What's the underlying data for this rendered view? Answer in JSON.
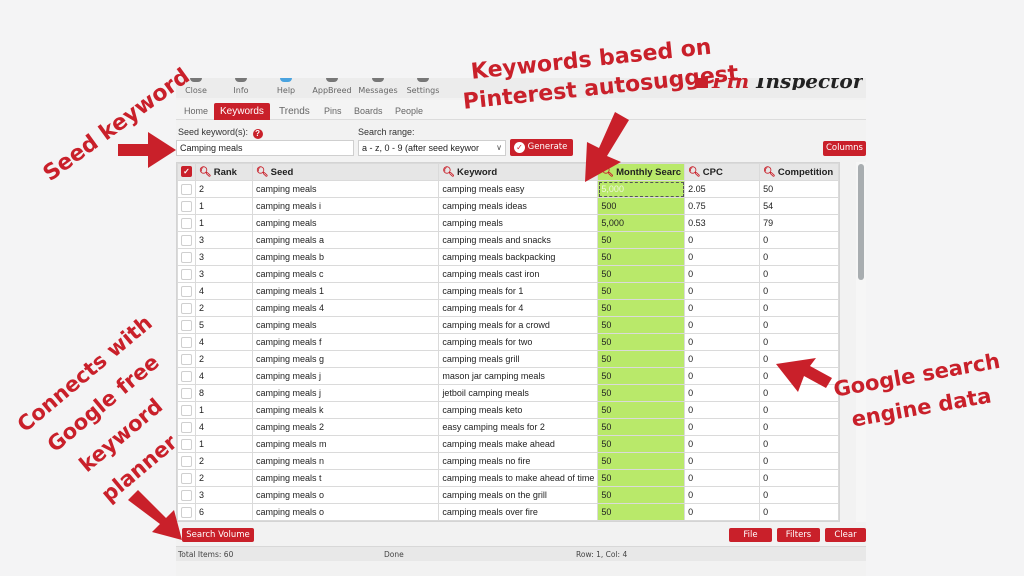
{
  "toolbar": {
    "items": [
      {
        "label": "Close",
        "icon": "close-icon"
      },
      {
        "label": "Info",
        "icon": "info-icon"
      },
      {
        "label": "Help",
        "icon": "help-icon"
      },
      {
        "label": "AppBreed",
        "icon": "appbreed-icon"
      },
      {
        "label": "Messages",
        "icon": "messages-icon"
      },
      {
        "label": "Settings",
        "icon": "settings-icon"
      }
    ],
    "logo": {
      "pin": "Pin",
      "rest": " Inspector"
    }
  },
  "tabs": [
    {
      "label": "Home",
      "active": false
    },
    {
      "label": "Keywords",
      "active": true
    },
    {
      "label": "Trends",
      "active": false
    },
    {
      "label": "Pins",
      "active": false
    },
    {
      "label": "Boards",
      "active": false
    },
    {
      "label": "People",
      "active": false
    }
  ],
  "form": {
    "seed_label": "Seed keyword(s):",
    "help_glyph": "?",
    "seed_value": "Camping meals",
    "range_label": "Search range:",
    "range_value": "a - z, 0 - 9 (after seed keywor",
    "generate_label": "Generate",
    "columns_label": "Columns"
  },
  "grid": {
    "columns": [
      "Rank",
      "Seed",
      "Keyword",
      "Monthly Searc",
      "CPC",
      "Competition"
    ],
    "rows": [
      {
        "rank": "2",
        "seed": "camping meals",
        "keyword": "camping meals easy",
        "monthly": "5,000",
        "cpc": "2.05",
        "competition": "50"
      },
      {
        "rank": "1",
        "seed": "camping meals i",
        "keyword": "camping meals ideas",
        "monthly": "500",
        "cpc": "0.75",
        "competition": "54"
      },
      {
        "rank": "1",
        "seed": "camping meals",
        "keyword": "camping meals",
        "monthly": "5,000",
        "cpc": "0.53",
        "competition": "79"
      },
      {
        "rank": "3",
        "seed": "camping meals a",
        "keyword": "camping meals and snacks",
        "monthly": "50",
        "cpc": "0",
        "competition": "0"
      },
      {
        "rank": "3",
        "seed": "camping meals b",
        "keyword": "camping meals backpacking",
        "monthly": "50",
        "cpc": "0",
        "competition": "0"
      },
      {
        "rank": "3",
        "seed": "camping meals c",
        "keyword": "camping meals cast iron",
        "monthly": "50",
        "cpc": "0",
        "competition": "0"
      },
      {
        "rank": "4",
        "seed": "camping meals 1",
        "keyword": "camping meals for 1",
        "monthly": "50",
        "cpc": "0",
        "competition": "0"
      },
      {
        "rank": "2",
        "seed": "camping meals 4",
        "keyword": "camping meals for 4",
        "monthly": "50",
        "cpc": "0",
        "competition": "0"
      },
      {
        "rank": "5",
        "seed": "camping meals",
        "keyword": "camping meals for a crowd",
        "monthly": "50",
        "cpc": "0",
        "competition": "0"
      },
      {
        "rank": "4",
        "seed": "camping meals f",
        "keyword": "camping meals for two",
        "monthly": "50",
        "cpc": "0",
        "competition": "0"
      },
      {
        "rank": "2",
        "seed": "camping meals g",
        "keyword": "camping meals grill",
        "monthly": "50",
        "cpc": "0",
        "competition": "0"
      },
      {
        "rank": "4",
        "seed": "camping meals j",
        "keyword": "mason jar camping meals",
        "monthly": "50",
        "cpc": "0",
        "competition": "0"
      },
      {
        "rank": "8",
        "seed": "camping meals j",
        "keyword": "jetboil camping meals",
        "monthly": "50",
        "cpc": "0",
        "competition": "0"
      },
      {
        "rank": "1",
        "seed": "camping meals k",
        "keyword": "camping meals keto",
        "monthly": "50",
        "cpc": "0",
        "competition": "0"
      },
      {
        "rank": "4",
        "seed": "camping meals 2",
        "keyword": "easy camping meals for 2",
        "monthly": "50",
        "cpc": "0",
        "competition": "0"
      },
      {
        "rank": "1",
        "seed": "camping meals m",
        "keyword": "camping meals make ahead",
        "monthly": "50",
        "cpc": "0",
        "competition": "0"
      },
      {
        "rank": "2",
        "seed": "camping meals n",
        "keyword": "camping meals no fire",
        "monthly": "50",
        "cpc": "0",
        "competition": "0"
      },
      {
        "rank": "2",
        "seed": "camping meals t",
        "keyword": "camping meals to make ahead of time",
        "monthly": "50",
        "cpc": "0",
        "competition": "0"
      },
      {
        "rank": "3",
        "seed": "camping meals o",
        "keyword": "camping meals on the grill",
        "monthly": "50",
        "cpc": "0",
        "competition": "0"
      },
      {
        "rank": "6",
        "seed": "camping meals o",
        "keyword": "camping meals over fire",
        "monthly": "50",
        "cpc": "0",
        "competition": "0"
      }
    ]
  },
  "buttons": {
    "search_volume": "Search Volume",
    "file": "File",
    "filters": "Filters",
    "clear": "Clear"
  },
  "status": {
    "total": "Total Items: 60",
    "state": "Done",
    "position": "Row: 1, Col: 4"
  },
  "annotations": {
    "seed": "Seed keyword",
    "autosuggest_1": "Keywords based on",
    "autosuggest_2": "Pinterest autosuggest",
    "google_1": "Google search",
    "google_2": "engine data",
    "planner_1": "Connects with",
    "planner_2": "Google free",
    "planner_3": "keyword",
    "planner_4": "planner"
  },
  "colors": {
    "accent": "#c9202a",
    "monthly_search_bg": "#b9e96a"
  }
}
